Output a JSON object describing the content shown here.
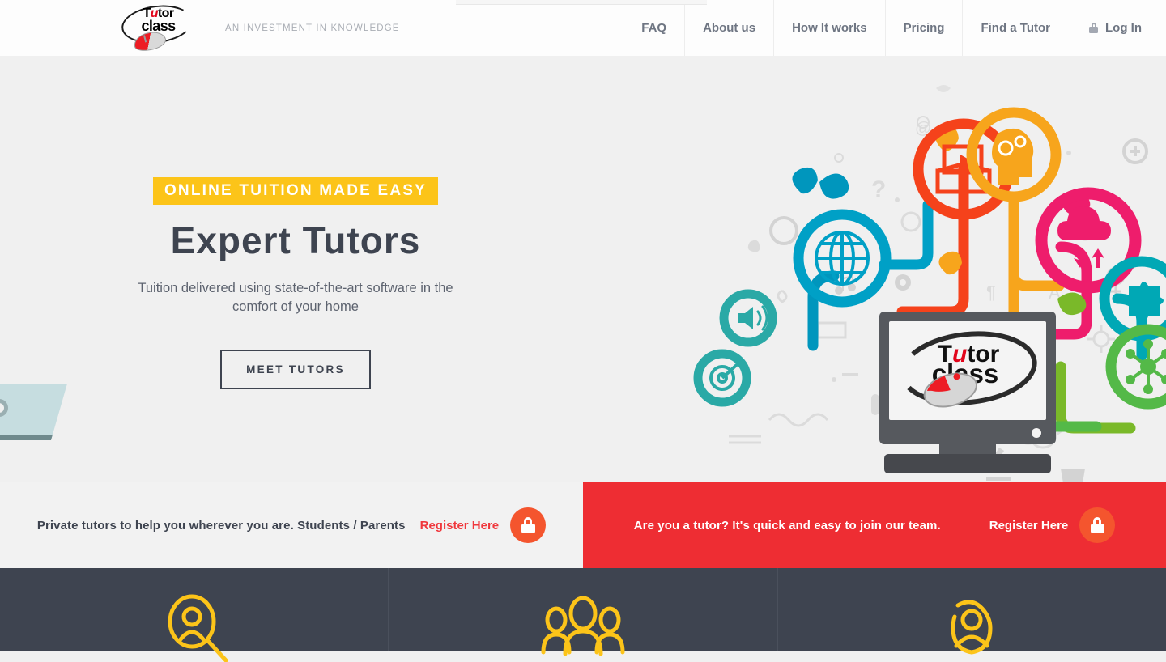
{
  "header": {
    "logo": {
      "line1": "T",
      "u": "u",
      "line1b": "tor",
      "line2": "class",
      "alt": "tutorclass-logo"
    },
    "tagline": "AN INVESTMENT IN KNOWLEDGE",
    "nav": [
      {
        "label": "FAQ",
        "name": "nav-faq"
      },
      {
        "label": "About us",
        "name": "nav-about-us"
      },
      {
        "label": "How It works",
        "name": "nav-how-it-works"
      },
      {
        "label": "Pricing",
        "name": "nav-pricing"
      },
      {
        "label": "Find a Tutor",
        "name": "nav-find-a-tutor"
      }
    ],
    "login": {
      "label": "Log In",
      "icon": "lock-icon"
    }
  },
  "hero": {
    "eyebrow": "ONLINE TUITION MADE EASY",
    "heading": "Expert Tutors",
    "subheading": "Tuition delivered using state-of-the-art software in the comfort of your home",
    "button": "MEET TUTORS",
    "illustration_logo": {
      "line1": "T",
      "u": "u",
      "line1b": "tor",
      "line2": "class"
    }
  },
  "cta": {
    "left": {
      "text": "Private tutors to help you wherever you are. Students / Parents",
      "link": "Register Here",
      "icon": "lock-icon"
    },
    "right": {
      "text": "Are you a tutor? It's quick and easy to join our team.",
      "link": "Register Here",
      "icon": "lock-icon"
    }
  },
  "features": [
    {
      "icon": "search-person-icon",
      "name": "feature-find-tutor"
    },
    {
      "icon": "group-people-icon",
      "name": "feature-community"
    },
    {
      "icon": "person-profile-icon",
      "name": "feature-profile"
    }
  ],
  "colors": {
    "accent_yellow": "#fcc419",
    "accent_red": "#ee2d33",
    "accent_orange": "#f4552e",
    "dark": "#3e4450",
    "page_bg": "#f0f0f0"
  }
}
